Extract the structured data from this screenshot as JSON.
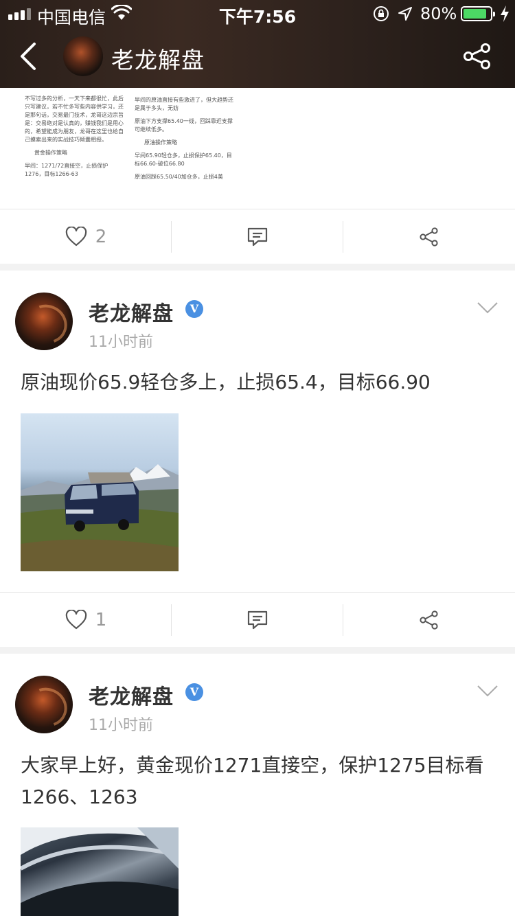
{
  "status_bar": {
    "carrier": "中国电信",
    "time": "下午7:56",
    "battery_percent": "80%",
    "battery_level": 0.8
  },
  "nav": {
    "title": "老龙解盘",
    "back_icon": "chevron-left-icon",
    "share_icon": "share-icon"
  },
  "article": {
    "left_col": [
      "不写过多的分析，一天下来都很忙，此后只写建议，若不忙多写些内容供学习，还是那句话，交易最门技术，龙哥这边宗旨是：交易绝对是认真的，赚钱我们是用心的，希望能成为朋友，龙哥在这里也给自己摸索出来的实战技巧倾囊相授。",
      "黄金操作策略",
      "早间：1271/72直接空，止损保护1276，目标1266-63"
    ],
    "right_col": [
      "早间的原油直接有些激进了，但大趋势还是属于多头，无妨",
      "原油下方支撑65.40一线，回踩靠近支撑可继续低多。",
      "原油操作策略",
      "早间65.90轻仓多，止损保护65.40，目标66.60-破位66.80",
      "原油回踩65.50/40加仓多，止损4美"
    ]
  },
  "actions_1": {
    "like_count": "2"
  },
  "posts": [
    {
      "author": "老龙解盘",
      "verified": "V",
      "time": "11小时前",
      "text": "原油现价65.9轻仓多上，止损65.4，目标66.90",
      "like_count": "1"
    },
    {
      "author": "老龙解盘",
      "verified": "V",
      "time": "11小时前",
      "text": "大家早上好，黄金现价1271直接空，保护1275目标看1266、1263"
    }
  ],
  "colors": {
    "accent_blue": "#4a90e2",
    "battery_green": "#4cd964",
    "header_brown": "#2f241e"
  }
}
